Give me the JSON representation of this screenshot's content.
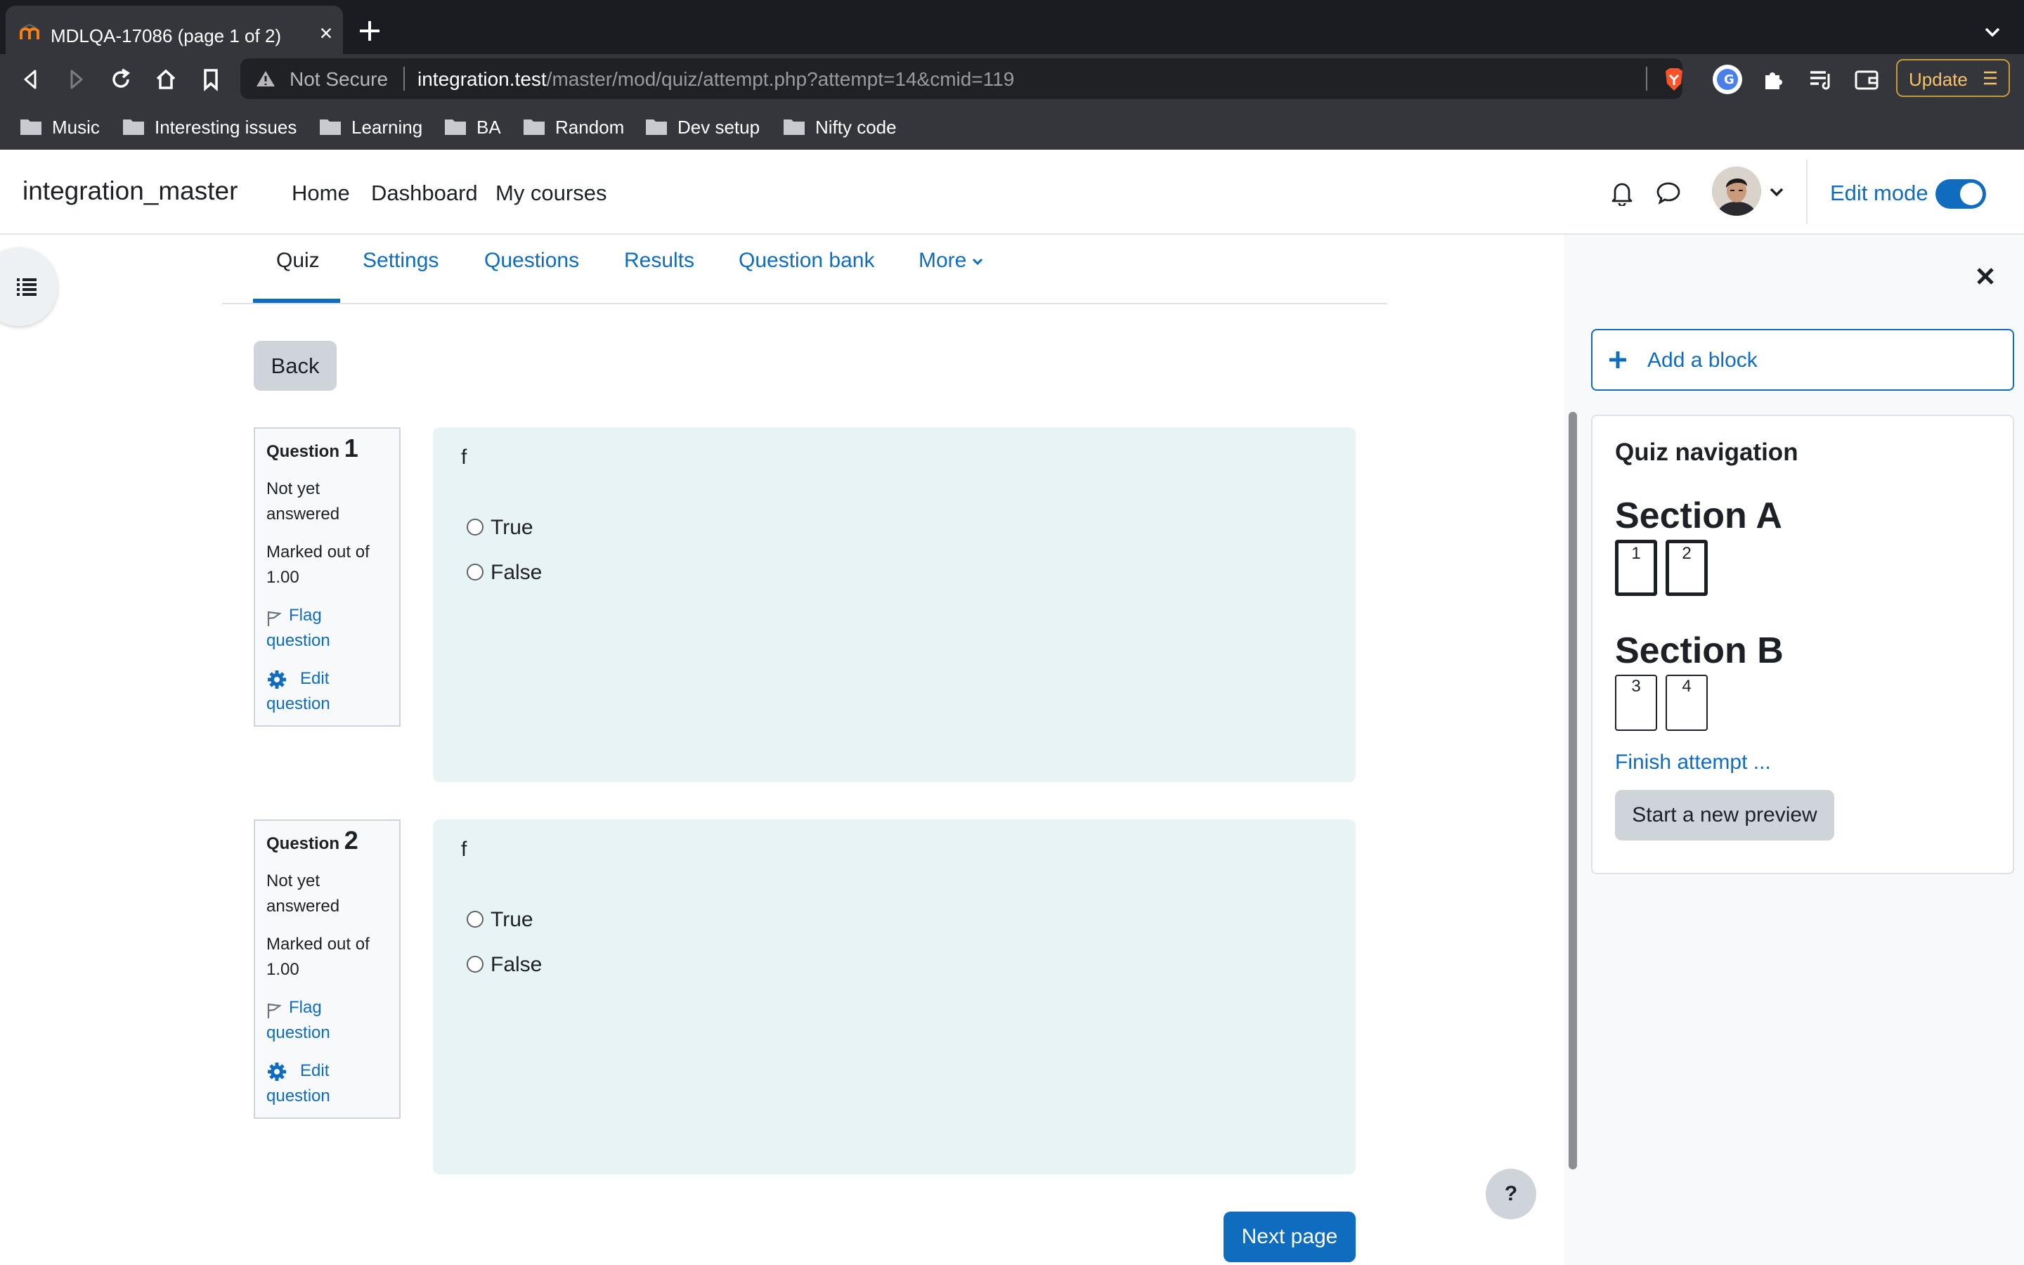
{
  "browser": {
    "tab_title": "MDLQA-17086 (page 1 of 2)",
    "tab_close": "×",
    "not_secure": "Not Secure",
    "url_host": "integration.test",
    "url_path": "/master/mod/quiz/attempt.php?attempt=14&cmid=119",
    "update_label": "Update",
    "bookmarks": [
      "Music",
      "Interesting issues",
      "Learning",
      "BA",
      "Random",
      "Dev setup",
      "Nifty code"
    ]
  },
  "navbar": {
    "site_name": "integration_master",
    "links": [
      "Home",
      "Dashboard",
      "My courses"
    ],
    "edit_mode_label": "Edit mode",
    "edit_mode_on": true
  },
  "secondary_nav": {
    "items": [
      "Quiz",
      "Settings",
      "Questions",
      "Results",
      "Question bank",
      "More"
    ],
    "active": "Quiz"
  },
  "back_label": "Back",
  "questions": [
    {
      "label": "Question",
      "number": "1",
      "state_line1": "Not yet",
      "state_line2": "answered",
      "grade_line1": "Marked out of",
      "grade_line2": "1.00",
      "flag_line1": "Flag",
      "flag_line2": "question",
      "edit_line1": "Edit",
      "edit_line2": "question",
      "text": "f",
      "options": [
        "True",
        "False"
      ]
    },
    {
      "label": "Question",
      "number": "2",
      "state_line1": "Not yet",
      "state_line2": "answered",
      "grade_line1": "Marked out of",
      "grade_line2": "1.00",
      "flag_line1": "Flag",
      "flag_line2": "question",
      "edit_line1": "Edit",
      "edit_line2": "question",
      "text": "f",
      "options": [
        "True",
        "False"
      ]
    }
  ],
  "next_page_label": "Next page",
  "help_label": "?",
  "drawer": {
    "add_block_label": "Add a block",
    "quiz_nav": {
      "title": "Quiz navigation",
      "sections": [
        {
          "title": "Section A",
          "buttons": [
            "1",
            "2"
          ]
        },
        {
          "title": "Section B",
          "buttons": [
            "3",
            "4"
          ]
        }
      ],
      "finish_label": "Finish attempt ...",
      "preview_label": "Start a new preview"
    }
  },
  "colors": {
    "accent": "#0f6cbf",
    "question_bg": "#e7f3f5",
    "browser_dark": "#1b1c21",
    "browser_toolbar": "#35363b"
  }
}
